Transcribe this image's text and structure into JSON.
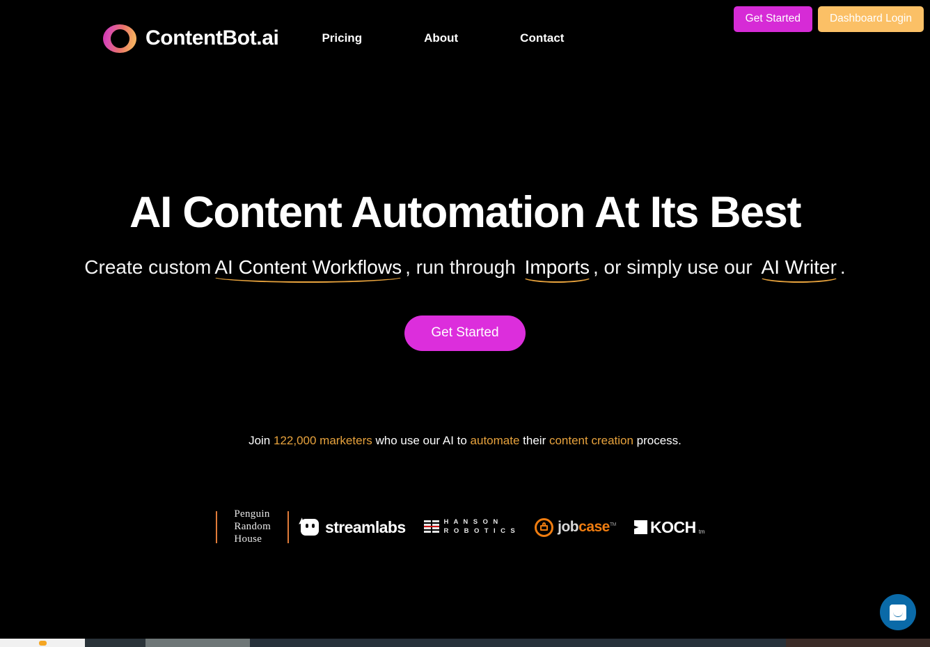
{
  "brand": {
    "name": "ContentBot.ai",
    "logo_icon": "gradient-ring-icon",
    "gradient_from": "#cc2ea8",
    "gradient_to": "#f7b96a"
  },
  "nav": {
    "items": [
      {
        "label": "Pricing"
      },
      {
        "label": "About"
      },
      {
        "label": "Contact"
      }
    ]
  },
  "auth": {
    "get_started_label": "Get Started",
    "get_started_color": "#d62bd6",
    "dashboard_login_label": "Dashboard Login",
    "dashboard_login_color": "#fbc066"
  },
  "hero": {
    "title": "AI Content Automation At Its Best",
    "subtitle": {
      "part1": "Create custom",
      "highlight1": "AI Content Workflows",
      "part2": ", run through ",
      "highlight2": "Imports",
      "part3": ", or simply use our ",
      "highlight3": "AI Writer",
      "part4": "."
    },
    "cta_label": "Get Started",
    "cta_color": "#dc2edc",
    "underline_color": "#e8a33d"
  },
  "social_proof": {
    "prefix": "Join ",
    "count": "122,000 marketers",
    "middle": " who use our AI to ",
    "action": "automate",
    "middle2": " their ",
    "subject": "content creation",
    "suffix": " process.",
    "accent_color": "#e8a33d"
  },
  "logos": {
    "penguin": {
      "line1": "Penguin",
      "line2": "Random",
      "line3": "House"
    },
    "streamlabs": {
      "name": "streamlabs"
    },
    "hanson": {
      "line1": "H A N S O N",
      "line2": "R O B O T I C S"
    },
    "jobcase": {
      "part1": "job",
      "part2": "case",
      "tm": "TM"
    },
    "koch": {
      "name": "KOCH",
      "tm": "tm"
    }
  },
  "chat": {
    "launcher_label": "chat-launcher",
    "color": "#0a6aa8"
  }
}
